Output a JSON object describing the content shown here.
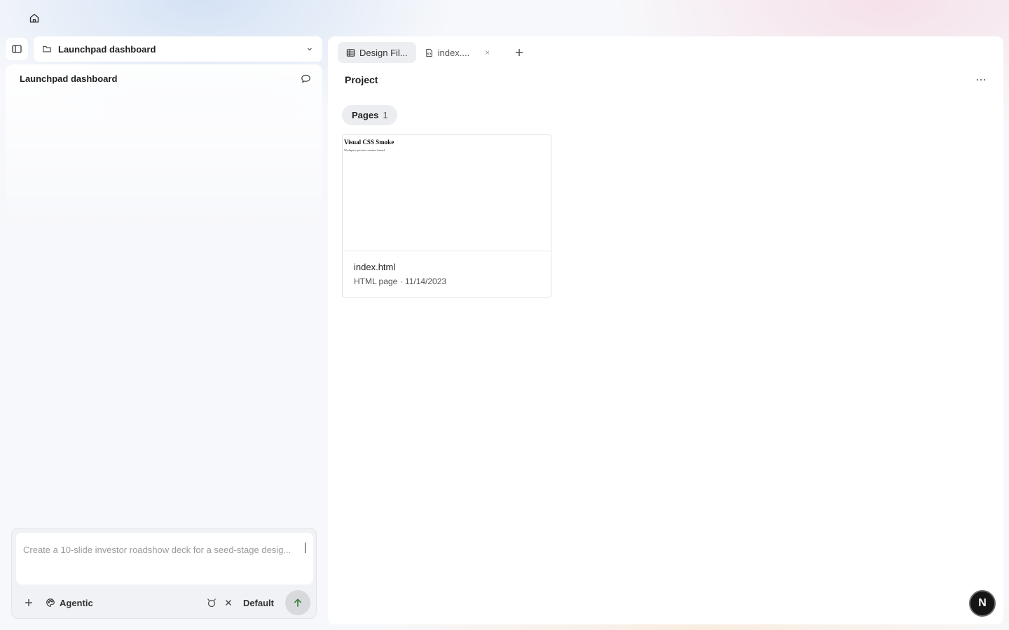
{
  "sidebar": {
    "project_name": "Launchpad dashboard",
    "chat_title": "Launchpad dashboard"
  },
  "composer": {
    "placeholder": "Create a 10-slide investor roadshow deck for a seed-stage desig...",
    "mode_label": "Agentic",
    "model_label": "Default"
  },
  "tabs": [
    {
      "label": "Design Fil...",
      "icon": "grid-icon",
      "active": true
    },
    {
      "label": "index....",
      "icon": "file-code-icon",
      "active": false,
      "close": "×"
    }
  ],
  "main": {
    "title": "Project",
    "pages_label": "Pages",
    "pages_count": "1"
  },
  "files": [
    {
      "name": "index.html",
      "meta": "HTML page · 11/14/2023",
      "preview_title": "Visual CSS Smoke",
      "preview_subtitle": "Workspace preview contains framed"
    }
  ],
  "user": {
    "avatar_letter": "N"
  },
  "colors": {
    "send_arrow": "#2e7d32",
    "avatar_bg": "#151515"
  }
}
